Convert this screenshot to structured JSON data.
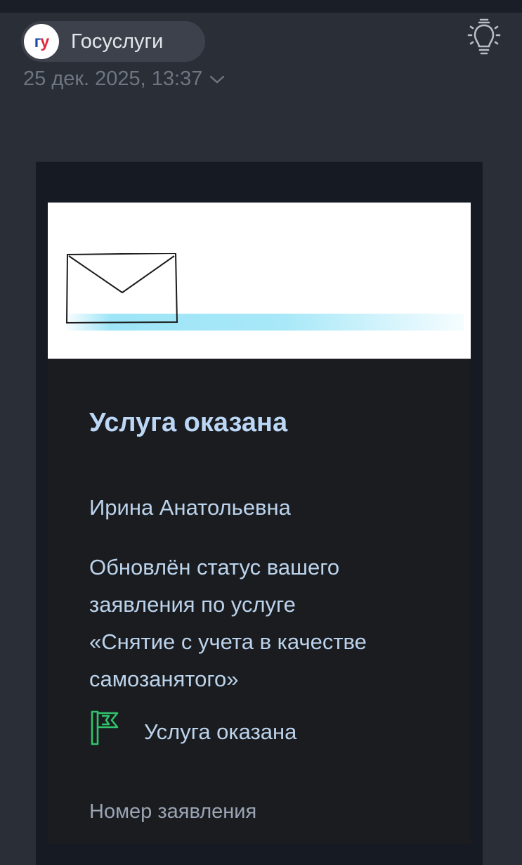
{
  "header": {
    "sender_logo_text_1": "г",
    "sender_logo_text_2": "у",
    "sender_name": "Госуслуги",
    "icons": [
      "lightbulb-icon",
      "chevron-down-icon"
    ],
    "date": "25 дек. 2025, 13:37"
  },
  "email": {
    "banner_icon": "envelope-icon",
    "title": "Услуга оказана",
    "greeting": "Ирина Анатольевна",
    "body_lines": [
      "Обновлён статус вашего",
      "заявления по услуге",
      "«Снятие с учета в качестве",
      "самозанятого»"
    ],
    "status_icon": "flag-icon",
    "status_label": "Услуга оказана",
    "application_number_label": "Номер заявления"
  },
  "colors": {
    "background": "#292e37",
    "card": "#151a23",
    "title": "#bcd7f5",
    "text": "#bcd3ec",
    "flag": "#2fc36a",
    "brand_blue": "#1a4aa8",
    "brand_red": "#e0263b"
  }
}
